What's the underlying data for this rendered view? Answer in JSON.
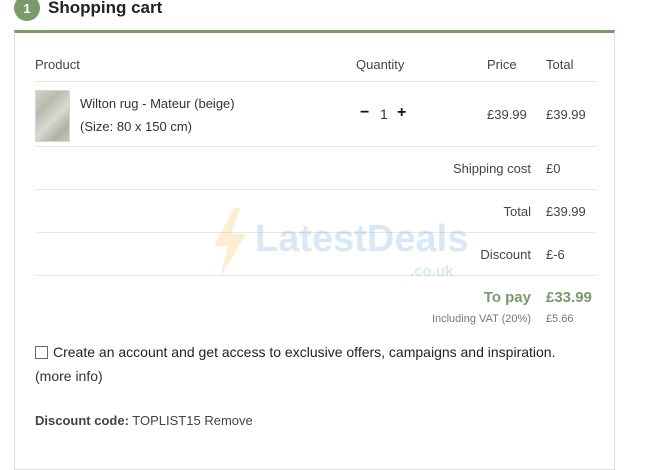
{
  "header": {
    "step": "1",
    "title": "Shopping cart"
  },
  "table": {
    "headers": {
      "product": "Product",
      "quantity": "Quantity",
      "price": "Price",
      "total": "Total"
    },
    "item": {
      "name": "Wilton rug - Mateur (beige)",
      "size": "(Size: 80 x 150 cm)",
      "qty_minus": "−",
      "qty_value": "1",
      "qty_plus": "+",
      "price": "£39.99",
      "total": "£39.99"
    }
  },
  "summary": {
    "shipping_label": "Shipping cost",
    "shipping_value": "£0",
    "total_label": "Total",
    "total_value": "£39.99",
    "discount_label": "Discount",
    "discount_value": "£-6",
    "topay_label": "To pay",
    "topay_value": "£33.99",
    "vat_label": "Including VAT (20%)",
    "vat_value": "£5.66"
  },
  "watermark": {
    "text": "LatestDeals",
    "sub": ".co.uk"
  },
  "account": {
    "checkbox_label": "Create an account and get access to exclusive offers, campaigns and inspiration.",
    "more_info": "(more info)"
  },
  "discount_code": {
    "label": "Discount code:",
    "code": "TOPLIST15",
    "remove": "Remove"
  },
  "colors": {
    "accent": "#7a9a6a"
  }
}
